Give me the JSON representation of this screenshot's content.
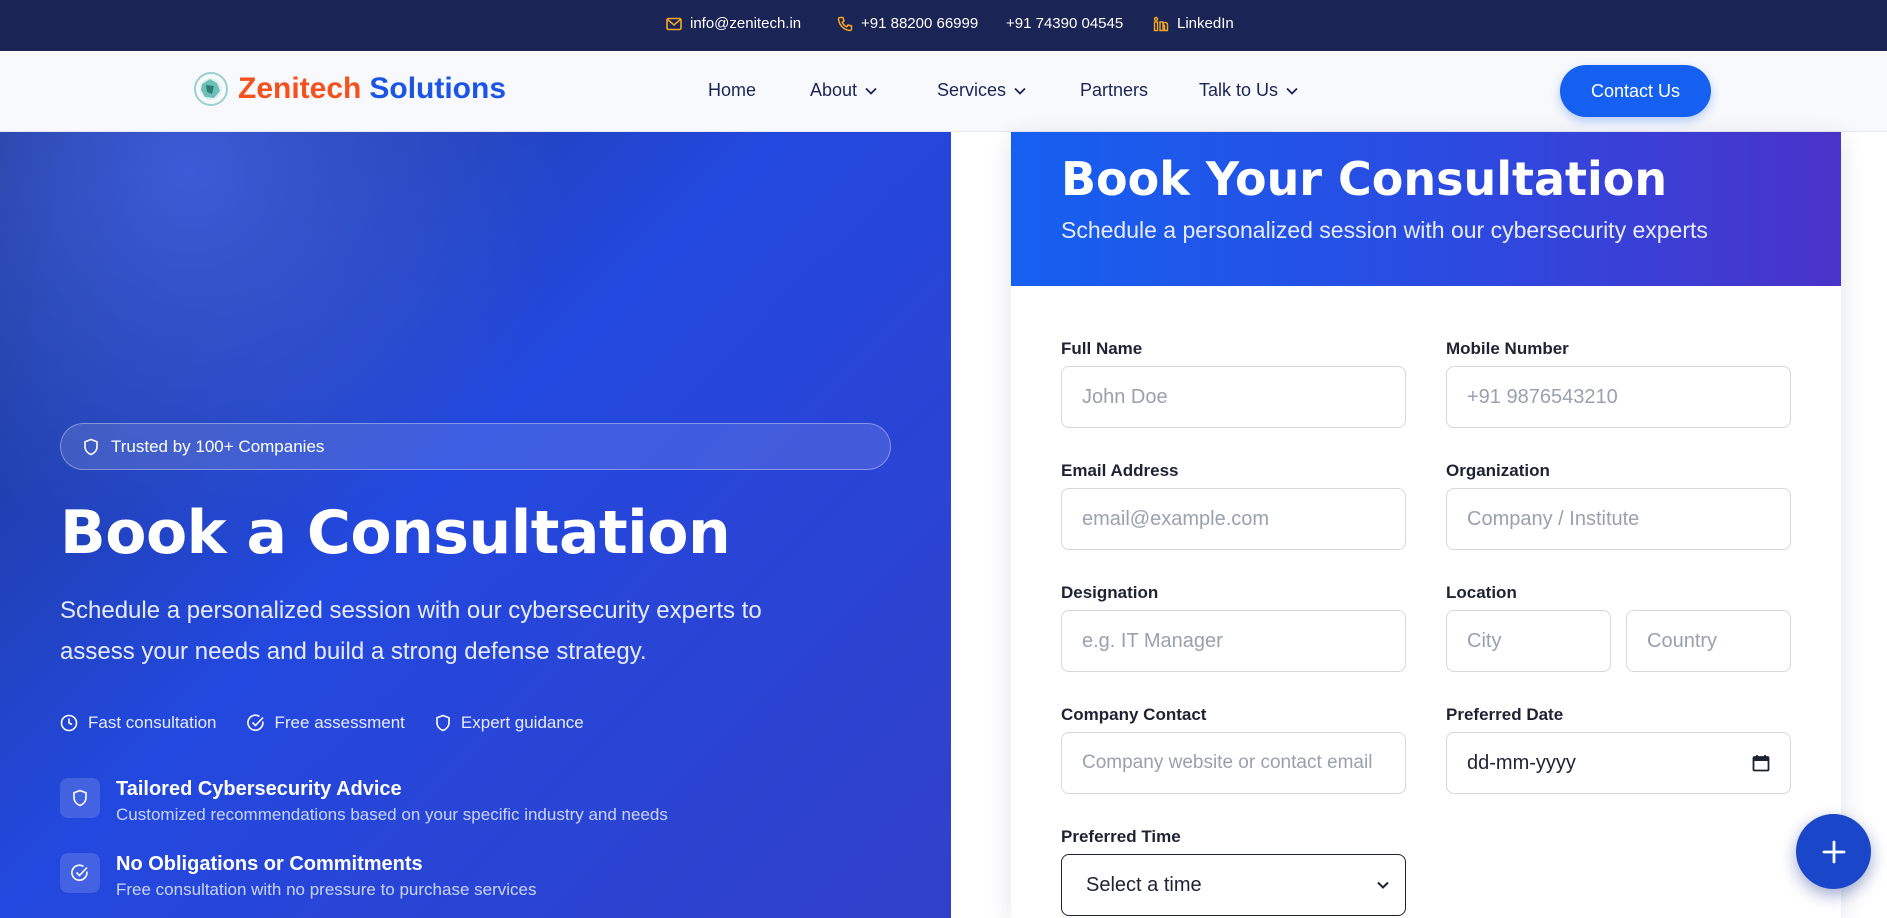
{
  "topbar": {
    "email": "info@zenitech.in",
    "phone1": "+91 88200 66999",
    "phone2": "+91 74390 04545",
    "social": "LinkedIn"
  },
  "nav": {
    "brand_primary": "Zenitech",
    "brand_secondary": "Solutions",
    "links": [
      {
        "label": "Home"
      },
      {
        "label": "About"
      },
      {
        "label": "Services"
      },
      {
        "label": "Partners"
      },
      {
        "label": "Talk to Us"
      }
    ],
    "cta": "Contact Us"
  },
  "hero": {
    "badge": "Trusted by 100+ Companies",
    "title": "Book a Consultation",
    "subtitle": "Schedule a personalized session with our cybersecurity experts to assess your needs and build a strong defense strategy.",
    "features": [
      "Fast consultation",
      "Free assessment",
      "Expert guidance"
    ],
    "benefits": [
      {
        "title": "Tailored Cybersecurity Advice",
        "desc": "Customized recommendations based on your specific industry and needs"
      },
      {
        "title": "No Obligations or Commitments",
        "desc": "Free consultation with no pressure to purchase services"
      }
    ]
  },
  "form": {
    "title": "Book Your Consultation",
    "subtitle": "Schedule a personalized session with our cybersecurity experts",
    "full_name": {
      "label": "Full Name",
      "placeholder": "John Doe"
    },
    "mobile": {
      "label": "Mobile Number",
      "placeholder": "+91 9876543210"
    },
    "email": {
      "label": "Email Address",
      "placeholder": "email@example.com"
    },
    "organization": {
      "label": "Organization",
      "placeholder": "Company / Institute"
    },
    "designation": {
      "label": "Designation",
      "placeholder": "e.g. IT Manager"
    },
    "location": {
      "label": "Location",
      "city_placeholder": "City",
      "country_placeholder": "Country"
    },
    "company_contact": {
      "label": "Company Contact",
      "placeholder": "Company website or contact email"
    },
    "preferred_date": {
      "label": "Preferred Date",
      "value": "dd-mm-yyyy"
    },
    "preferred_time": {
      "label": "Preferred Time",
      "value": "Select a time"
    }
  },
  "colors": {
    "topbar_bg": "#1a2455",
    "accent": "#1560f0",
    "brand_orange": "#f4511e",
    "icon_gold": "#f5a623"
  }
}
